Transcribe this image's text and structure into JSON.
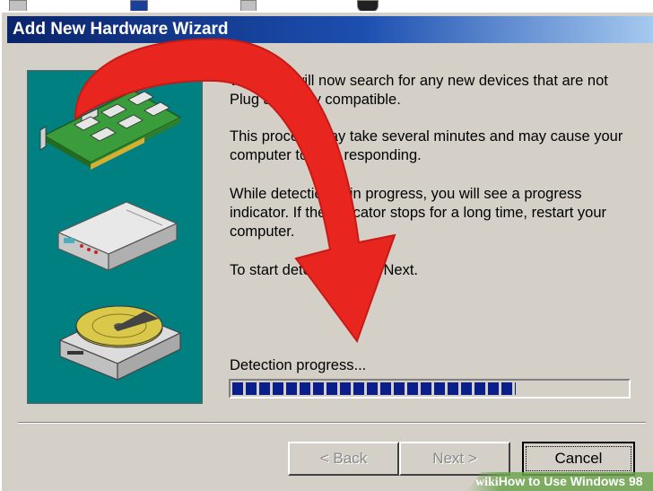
{
  "window": {
    "title": "Add New Hardware Wizard"
  },
  "body": {
    "paragraph_1": "Windows will now search for any new devices that are not Plug and Play compatible.",
    "paragraph_2": "This process may take several minutes and may cause your computer to stop responding.",
    "paragraph_3": "While detection is in progress, you will see a progress indicator. If the indicator stops for a long time, restart your computer.",
    "paragraph_4": "To start detection, click Next."
  },
  "progress": {
    "label": "Detection progress...",
    "fraction": 0.72
  },
  "buttons": {
    "back": "< Back",
    "next": "Next >",
    "cancel": "Cancel"
  },
  "watermark": {
    "brand": "wiki",
    "text": "How to Use Windows 98"
  },
  "colors": {
    "titlebar_start": "#0a246a",
    "side_panel": "#008080",
    "progress_fill": "#0a1f8a",
    "annotation_arrow": "#e8261f"
  },
  "icons": [
    "expansion-card-icon",
    "external-drive-icon",
    "hard-disk-icon",
    "red-arrow-annotation"
  ]
}
